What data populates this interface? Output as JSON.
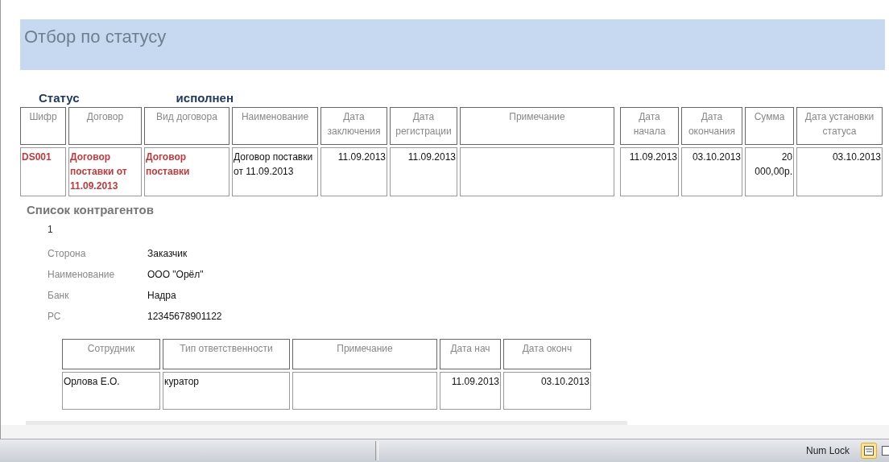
{
  "report": {
    "title": "Отбор по статусу",
    "status_label": "Статус",
    "status_value": "исполнен"
  },
  "contracts": {
    "columns": [
      "Шифр",
      "Договор",
      "Вид договора",
      "Наименование",
      "Дата заключения",
      "Дата регистрации",
      "Примечание",
      "Дата начала",
      "Дата окончания",
      "Сумма",
      "Дата установки статуса"
    ],
    "rows": [
      [
        {
          "text": "DS001",
          "highlighted": true
        },
        {
          "text": "Договор поставки от 11.09.2013",
          "highlighted": true
        },
        {
          "text": "Договор поставки",
          "highlighted": true
        },
        {
          "text": "Договор поставки от 11.09.2013",
          "highlighted": false
        },
        {
          "text": "11.09.2013",
          "highlighted": false
        },
        {
          "text": "11.09.2013",
          "highlighted": false
        },
        {
          "text": ""
        },
        {
          "text": "11.09.2013",
          "highlighted": false
        },
        {
          "text": "03.10.2013",
          "highlighted": false
        },
        {
          "text": "20 000,00р.",
          "highlighted": false
        },
        {
          "text": "03.10.2013",
          "highlighted": false
        }
      ]
    ]
  },
  "counterparties": {
    "title": "Список контрагентов",
    "number": "1",
    "fields": [
      {
        "label": "Сторона",
        "value": "Заказчик"
      },
      {
        "label": "Наименование",
        "value": "ООО \"Орёл\""
      },
      {
        "label": "Банк",
        "value": "Надра"
      },
      {
        "label": "РС",
        "value": "12345678901122"
      }
    ]
  },
  "staff": {
    "columns": [
      "Сотрудник",
      "Тип ответственности",
      "Примечание",
      "Дата нач",
      "Дата оконч"
    ],
    "rows": [
      [
        "Орлова Е.О.",
        "куратор",
        "",
        "11.09.2013",
        "03.10.2013"
      ]
    ]
  },
  "status_bar": {
    "num_lock": "Num Lock"
  }
}
